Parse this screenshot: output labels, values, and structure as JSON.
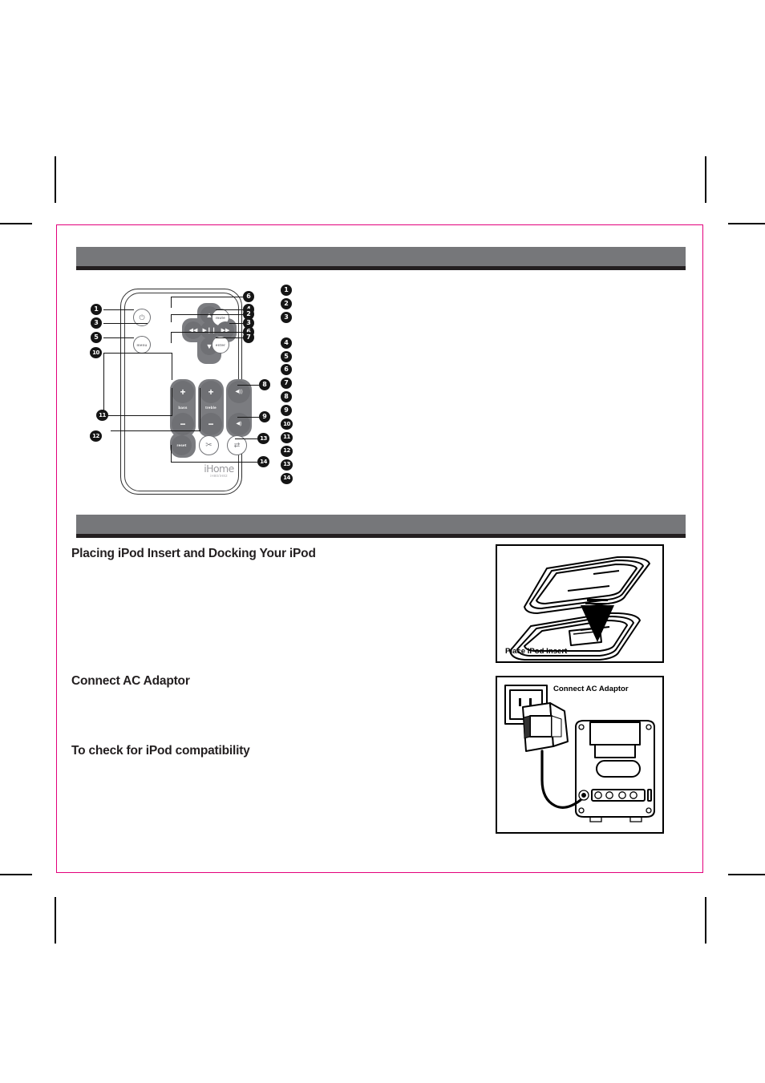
{
  "page": {
    "bleed_color": "#ffffff",
    "trim_box_color": "#e3007c",
    "header_bar_color": "#76777a",
    "header_bar_rule_color": "#231f20"
  },
  "sections": {
    "remote_header": {
      "label": ""
    },
    "setup_header": {
      "label": ""
    }
  },
  "remote": {
    "brand": "iHome",
    "model": "iH80/iH82",
    "buttons": [
      {
        "name": "power",
        "glyph": "⏻",
        "type": "ring"
      },
      {
        "name": "up",
        "glyph": "▲",
        "type": "solid"
      },
      {
        "name": "mute",
        "text": "mute",
        "type": "ring"
      },
      {
        "name": "rewind",
        "glyph": "◀◀",
        "type": "solid"
      },
      {
        "name": "play-pause",
        "glyph": "▶❙❙",
        "type": "solid"
      },
      {
        "name": "fast-forward",
        "glyph": "▶▶",
        "type": "solid"
      },
      {
        "name": "menu",
        "text": "menu",
        "type": "ring"
      },
      {
        "name": "down",
        "glyph": "▼",
        "type": "solid"
      },
      {
        "name": "enter",
        "text": "enter",
        "type": "ring"
      },
      {
        "name": "bass-up",
        "glyph": "+",
        "type": "solid"
      },
      {
        "name": "bass-down",
        "glyph": "−",
        "type": "solid"
      },
      {
        "name": "treble-up",
        "glyph": "+",
        "type": "solid"
      },
      {
        "name": "treble-down",
        "glyph": "−",
        "type": "solid"
      },
      {
        "name": "volume-up",
        "glyph": "◀))",
        "type": "solid"
      },
      {
        "name": "volume-down",
        "glyph": "◀)",
        "type": "solid"
      },
      {
        "name": "reset",
        "text": "reset",
        "type": "solid"
      },
      {
        "name": "shuffle",
        "glyph": "✂",
        "type": "ring"
      },
      {
        "name": "repeat",
        "glyph": "⇄",
        "type": "ring"
      }
    ],
    "pad_labels": {
      "bass": "bass",
      "treble": "treble"
    },
    "callouts": [
      {
        "n": "1",
        "target": "power"
      },
      {
        "n": "2",
        "target": "play-pause"
      },
      {
        "n": "3",
        "target": "rewind"
      },
      {
        "n": "3",
        "target": "fast-forward"
      },
      {
        "n": "4",
        "target": "mute"
      },
      {
        "n": "5",
        "target": "menu"
      },
      {
        "n": "6",
        "target": "up"
      },
      {
        "n": "6",
        "target": "down"
      },
      {
        "n": "7",
        "target": "enter"
      },
      {
        "n": "8",
        "target": "volume-up"
      },
      {
        "n": "9",
        "target": "volume-down"
      },
      {
        "n": "10",
        "target": "bass"
      },
      {
        "n": "11",
        "target": "treble"
      },
      {
        "n": "12",
        "target": "reset"
      },
      {
        "n": "13",
        "target": "repeat"
      },
      {
        "n": "14",
        "target": "shuffle"
      }
    ]
  },
  "legend": {
    "items": [
      {
        "n": "1",
        "label": ""
      },
      {
        "n": "2",
        "label": ""
      },
      {
        "n": "3",
        "label": ""
      },
      {
        "n": "4",
        "label": ""
      },
      {
        "n": "5",
        "label": ""
      },
      {
        "n": "6",
        "label": ""
      },
      {
        "n": "7",
        "label": ""
      },
      {
        "n": "8",
        "label": ""
      },
      {
        "n": "9",
        "label": ""
      },
      {
        "n": "10",
        "label": ""
      },
      {
        "n": "11",
        "label": ""
      },
      {
        "n": "12",
        "label": ""
      },
      {
        "n": "13",
        "label": ""
      },
      {
        "n": "14",
        "label": ""
      }
    ]
  },
  "setup": {
    "placing_heading": "Placing iPod Insert and Docking Your iPod",
    "placing_body": "",
    "connect_heading": "Connect AC Adaptor",
    "connect_body": "",
    "compat_heading": "To check for iPod compatibility",
    "compat_body": ""
  },
  "figures": {
    "insert": {
      "caption": "Place iPod Insert"
    },
    "adaptor": {
      "caption": "Connect AC Adaptor"
    }
  }
}
